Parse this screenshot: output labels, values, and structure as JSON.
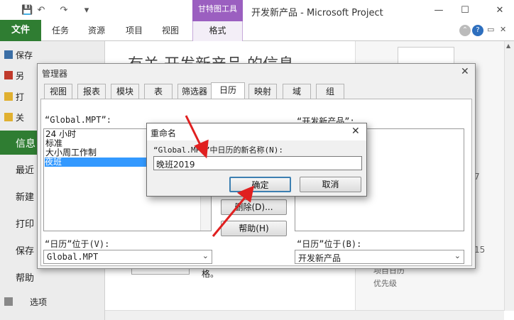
{
  "titlebar": {
    "app_title": "开发新产品 - Microsoft Project",
    "context_group": "甘特图工具",
    "minimize": "—",
    "maximize": "☐",
    "close": "✕"
  },
  "ribbon": {
    "file": "文件",
    "tabs": [
      "任务",
      "资源",
      "项目",
      "视图"
    ],
    "format": "格式"
  },
  "sidebar": {
    "top_items": [
      "保存",
      "另",
      "打",
      "关"
    ],
    "info": "信息",
    "items": [
      "最近",
      "新建",
      "打印",
      "保存",
      "帮助"
    ],
    "options": "选项"
  },
  "main": {
    "info_title": "有关 开发新产品 的信息",
    "fragment_ge": "格。",
    "side_digits_1": "7",
    "side_digits_2": "15",
    "side_text_1": "项目日历",
    "side_text_2": "优先级"
  },
  "organizer": {
    "title": "管理器",
    "close": "✕",
    "tabs": [
      "视图",
      "报表",
      "模块",
      "表",
      "筛选器",
      "日历",
      "映射",
      "域",
      "组"
    ],
    "active_tab": "日历",
    "left_label": "“Global.MPT”:",
    "right_label": "“开发新产品”:",
    "left_items": [
      "24 小时",
      "标准",
      "大小周工作制",
      "夜班"
    ],
    "left_selected": "夜班",
    "delete_button": "删除(D)...",
    "help_button": "帮助(H)",
    "left_in_label": "“日历”位于(V):",
    "left_in_value": "Global.MPT",
    "right_in_label": "“日历”位于(B):",
    "right_in_value": "开发新产品"
  },
  "rename": {
    "title": "重命名",
    "close": "✕",
    "prompt": "“Global.MPT”中日历的新名称(N):",
    "value": "晚班2019",
    "ok": "确定",
    "cancel": "取消"
  },
  "colors": {
    "accent_green": "#2f7d32",
    "context_purple": "#9b5fc0",
    "selection_blue": "#3399ff",
    "annotation_red": "#e02020"
  }
}
